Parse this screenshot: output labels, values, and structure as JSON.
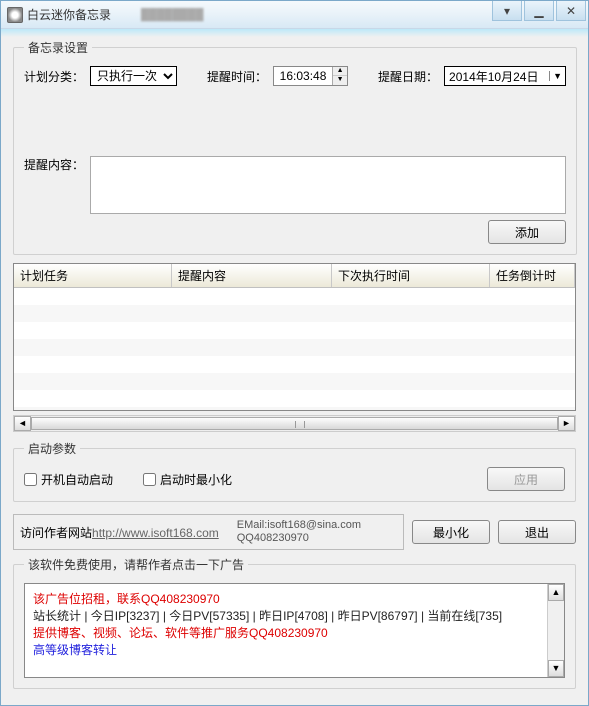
{
  "titlebar": {
    "title": "白云迷你备忘录"
  },
  "settings": {
    "legend": "备忘录设置",
    "plan_category_label": "计划分类：",
    "plan_category_value": "只执行一次",
    "remind_time_label": "提醒时间：",
    "remind_time_value": "16:03:48",
    "remind_date_label": "提醒日期：",
    "remind_date_value": "2014年10月24日",
    "content_label": "提醒内容：",
    "add_button": "添加"
  },
  "table": {
    "columns": [
      "计划任务",
      "提醒内容",
      "下次执行时间",
      "任务倒计时"
    ]
  },
  "startup": {
    "legend": "启动参数",
    "auto_start": "开机自动启动",
    "start_min": "启动时最小化",
    "apply": "应用"
  },
  "links": {
    "visit_label": "访问作者网站",
    "url": "http://www.isoft168.com",
    "email": "EMail:isoft168@sina.com",
    "qq": "QQ408230970",
    "minimize": "最小化",
    "exit": "退出"
  },
  "ad": {
    "legend": "该软件免费使用，请帮作者点击一下广告",
    "line1": "该广告位招租，联系QQ408230970",
    "stats": "站长统计  | 今日IP[3237]  | 今日PV[57335]  | 昨日IP[4708]  | 昨日PV[86797]  | 当前在线[735]",
    "line3": "提供博客、视频、论坛、软件等推广服务QQ408230970",
    "line4": "高等级博客转让"
  }
}
